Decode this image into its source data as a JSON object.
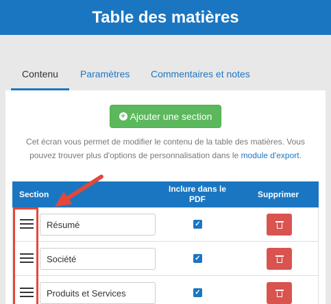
{
  "header": {
    "title": "Table des matières"
  },
  "tabs": [
    {
      "label": "Contenu",
      "active": true
    },
    {
      "label": "Paramètres",
      "active": false
    },
    {
      "label": "Commentaires et notes",
      "active": false
    }
  ],
  "actions": {
    "add_section_label": "Ajouter une section",
    "add_icon": "plus-circle-icon"
  },
  "description": {
    "text": "Cet écran vous permet de modifier le contenu de la table des matières. Vous pouvez trouver plus d'options de personnalisation dans le ",
    "link": "module d'export",
    "end": "."
  },
  "table": {
    "columns": [
      "Section",
      "Inclure dans le PDF",
      "Supprimer"
    ],
    "rows": [
      {
        "name": "Résumé",
        "include": true
      },
      {
        "name": "Société",
        "include": true
      },
      {
        "name": "Produits et Services",
        "include": true
      }
    ]
  },
  "colors": {
    "primary": "#1b76c1",
    "success": "#5cb85c",
    "danger": "#d9534f",
    "annotation": "#e4473a"
  }
}
